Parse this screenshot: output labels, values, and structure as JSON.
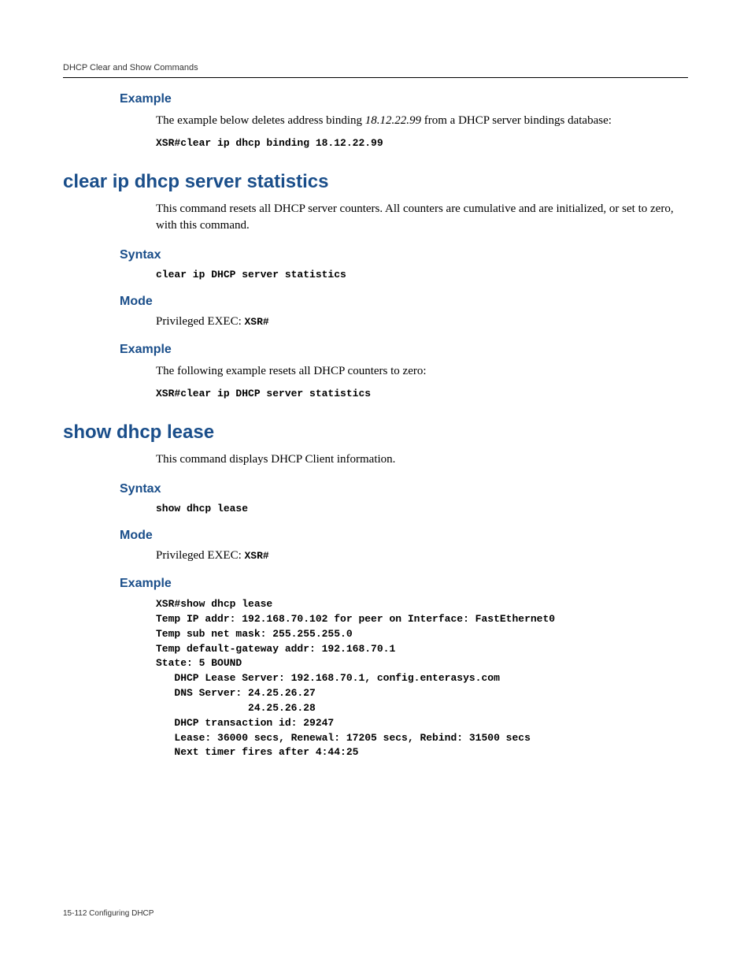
{
  "runningHead": "DHCP Clear and Show Commands",
  "footer": "15-112   Configuring DHCP",
  "sec0": {
    "exampleHeading": "Example",
    "exampleIntro_pre": "The example below deletes address binding ",
    "exampleIntro_ip": "18.12.22.99",
    "exampleIntro_post": " from a DHCP server bindings database:",
    "cmd": "XSR#clear ip dhcp binding 18.12.22.99"
  },
  "sec1": {
    "title": "clear ip dhcp server statistics",
    "intro": "This command resets all DHCP server counters. All counters are cumulative and are initialized, or set to zero, with this command.",
    "syntaxHeading": "Syntax",
    "syntaxCmd": "clear ip DHCP server statistics",
    "modeHeading": "Mode",
    "modeLabel": "Privileged EXEC: ",
    "modePrompt": "XSR#",
    "exampleHeading": "Example",
    "exampleIntro": "The following example resets all DHCP counters to zero:",
    "exampleCmd": "XSR#clear ip DHCP server statistics"
  },
  "sec2": {
    "title": "show dhcp lease",
    "intro": "This command displays DHCP Client information.",
    "syntaxHeading": "Syntax",
    "syntaxCmd": "show dhcp lease",
    "modeHeading": "Mode",
    "modeLabel": "Privileged EXEC: ",
    "modePrompt": "XSR#",
    "exampleHeading": "Example",
    "output": "XSR#show dhcp lease\nTemp IP addr: 192.168.70.102 for peer on Interface: FastEthernet0\nTemp sub net mask: 255.255.255.0\nTemp default-gateway addr: 192.168.70.1\nState: 5 BOUND\n   DHCP Lease Server: 192.168.70.1, config.enterasys.com\n   DNS Server: 24.25.26.27\n               24.25.26.28\n   DHCP transaction id: 29247\n   Lease: 36000 secs, Renewal: 17205 secs, Rebind: 31500 secs\n   Next timer fires after 4:44:25"
  }
}
